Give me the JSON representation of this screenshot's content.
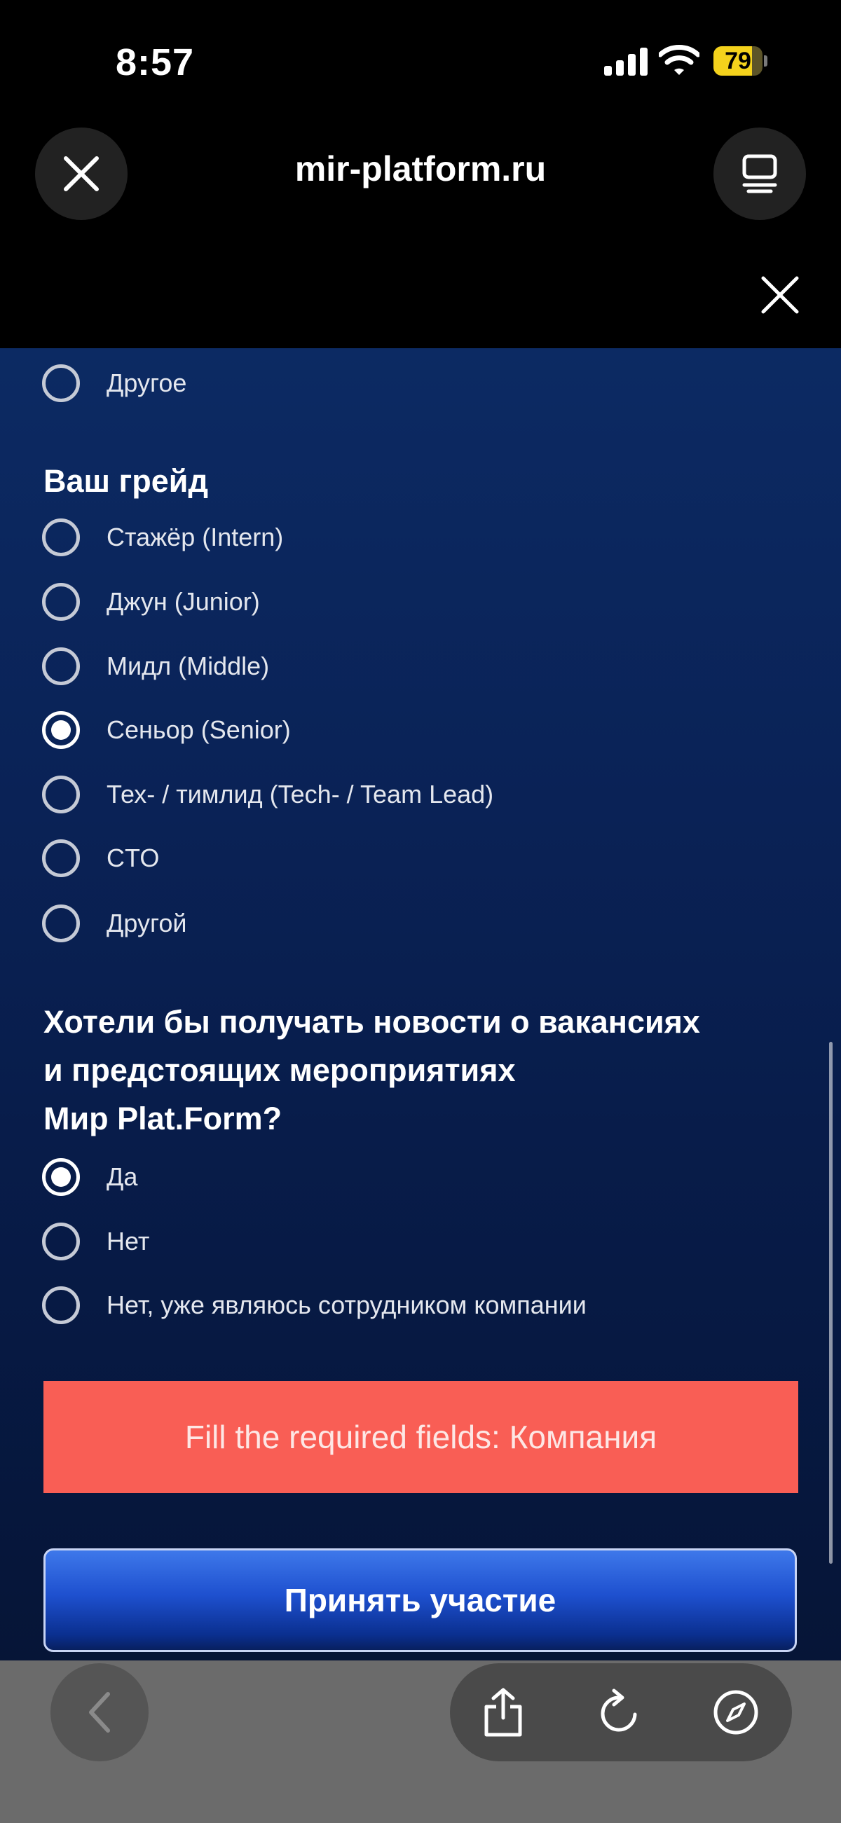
{
  "status_bar": {
    "time": "8:57",
    "battery": "79",
    "battery_level": 0.79
  },
  "browser": {
    "url": "mir-platform.ru"
  },
  "form": {
    "top_option": {
      "label": "Другое",
      "checked": false
    },
    "grade": {
      "heading": "Ваш грейд",
      "options": [
        {
          "label": "Стажёр (Intern)",
          "checked": false
        },
        {
          "label": "Джун (Junior)",
          "checked": false
        },
        {
          "label": "Мидл (Middle)",
          "checked": false
        },
        {
          "label": "Сеньор (Senior)",
          "checked": true
        },
        {
          "label": "Тех- / тимлид (Tech- / Team Lead)",
          "checked": false
        },
        {
          "label": "CTO",
          "checked": false
        },
        {
          "label": "Другой",
          "checked": false
        }
      ]
    },
    "news": {
      "heading_line1": "Хотели бы получать новости о вакансиях",
      "heading_line2": "и предстоящих мероприятиях",
      "heading_line3": "Мир Plat.Form?",
      "options": [
        {
          "label": "Да",
          "checked": true
        },
        {
          "label": "Нет",
          "checked": false
        },
        {
          "label": "Нет, уже являюсь сотрудником компании",
          "checked": false
        }
      ]
    },
    "error_message": "Fill the required fields: Компания",
    "submit_label": "Принять участие"
  },
  "colors": {
    "error_bg": "#f95e55",
    "button_blue": "#1e50cf",
    "page_bg": "#0a2256",
    "battery_yellow": "#f4d21c"
  },
  "icons": {
    "close": "close-icon",
    "tabs": "tabs-icon",
    "dismiss": "close-icon",
    "back": "chevron-left-icon",
    "share": "share-icon",
    "reload": "reload-icon",
    "compass": "compass-icon"
  }
}
